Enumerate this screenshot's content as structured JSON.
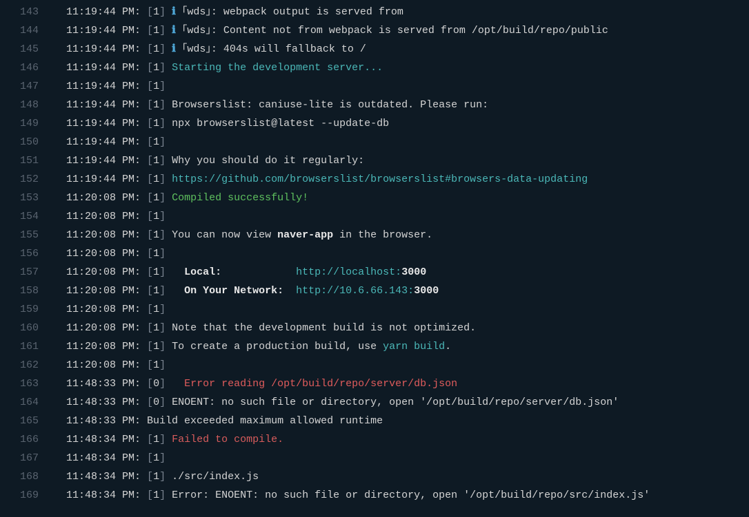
{
  "lines": [
    {
      "num": "143",
      "ts": "11:19:44 PM:",
      "worker": "[1]",
      "segs": [
        {
          "t": " ",
          "c": "txt"
        },
        {
          "t": "ℹ",
          "c": "info-icon"
        },
        {
          "t": " ｢wds｣",
          "c": "wds-bracket"
        },
        {
          "t": ": webpack output is served from",
          "c": "txt"
        }
      ]
    },
    {
      "num": "144",
      "ts": "11:19:44 PM:",
      "worker": "[1]",
      "segs": [
        {
          "t": " ",
          "c": "txt"
        },
        {
          "t": "ℹ",
          "c": "info-icon"
        },
        {
          "t": " ｢wds｣",
          "c": "wds-bracket"
        },
        {
          "t": ": Content not from webpack is served from /opt/build/repo/public",
          "c": "txt"
        }
      ]
    },
    {
      "num": "145",
      "ts": "11:19:44 PM:",
      "worker": "[1]",
      "segs": [
        {
          "t": " ",
          "c": "txt"
        },
        {
          "t": "ℹ",
          "c": "info-icon"
        },
        {
          "t": " ｢wds｣",
          "c": "wds-bracket"
        },
        {
          "t": ": 404s will fallback to /",
          "c": "txt"
        }
      ]
    },
    {
      "num": "146",
      "ts": "11:19:44 PM:",
      "worker": "[1]",
      "segs": [
        {
          "t": " Starting the development server...",
          "c": "cyan"
        }
      ]
    },
    {
      "num": "147",
      "ts": "11:19:44 PM:",
      "worker": "[1]",
      "segs": []
    },
    {
      "num": "148",
      "ts": "11:19:44 PM:",
      "worker": "[1]",
      "segs": [
        {
          "t": " Browserslist: caniuse-lite is outdated. Please run:",
          "c": "txt"
        }
      ]
    },
    {
      "num": "149",
      "ts": "11:19:44 PM:",
      "worker": "[1]",
      "segs": [
        {
          "t": " npx browserslist@latest --update-db",
          "c": "txt"
        }
      ]
    },
    {
      "num": "150",
      "ts": "11:19:44 PM:",
      "worker": "[1]",
      "segs": []
    },
    {
      "num": "151",
      "ts": "11:19:44 PM:",
      "worker": "[1]",
      "segs": [
        {
          "t": " Why you should do it regularly:",
          "c": "txt"
        }
      ]
    },
    {
      "num": "152",
      "ts": "11:19:44 PM:",
      "worker": "[1]",
      "segs": [
        {
          "t": " https://github.com/browserslist/browserslist#browsers-data-updating",
          "c": "link"
        }
      ]
    },
    {
      "num": "153",
      "ts": "11:20:08 PM:",
      "worker": "[1]",
      "segs": [
        {
          "t": " Compiled successfully!",
          "c": "green"
        }
      ]
    },
    {
      "num": "154",
      "ts": "11:20:08 PM:",
      "worker": "[1]",
      "segs": []
    },
    {
      "num": "155",
      "ts": "11:20:08 PM:",
      "worker": "[1]",
      "segs": [
        {
          "t": " You can now view ",
          "c": "txt"
        },
        {
          "t": "naver-app",
          "c": "bold"
        },
        {
          "t": " in the browser.",
          "c": "txt"
        }
      ]
    },
    {
      "num": "156",
      "ts": "11:20:08 PM:",
      "worker": "[1]",
      "segs": []
    },
    {
      "num": "157",
      "ts": "11:20:08 PM:",
      "worker": "[1]",
      "segs": [
        {
          "t": "   ",
          "c": "txt"
        },
        {
          "t": "Local:",
          "c": "bold"
        },
        {
          "t": "            ",
          "c": "txt"
        },
        {
          "t": "http://localhost:",
          "c": "link"
        },
        {
          "t": "3000",
          "c": "port"
        }
      ]
    },
    {
      "num": "158",
      "ts": "11:20:08 PM:",
      "worker": "[1]",
      "segs": [
        {
          "t": "   ",
          "c": "txt"
        },
        {
          "t": "On Your Network:",
          "c": "bold"
        },
        {
          "t": "  ",
          "c": "txt"
        },
        {
          "t": "http://10.6.66.143:",
          "c": "link"
        },
        {
          "t": "3000",
          "c": "port"
        }
      ]
    },
    {
      "num": "159",
      "ts": "11:20:08 PM:",
      "worker": "[1]",
      "segs": []
    },
    {
      "num": "160",
      "ts": "11:20:08 PM:",
      "worker": "[1]",
      "segs": [
        {
          "t": " Note that the development build is not optimized.",
          "c": "txt"
        }
      ]
    },
    {
      "num": "161",
      "ts": "11:20:08 PM:",
      "worker": "[1]",
      "segs": [
        {
          "t": " To create a production build, use ",
          "c": "txt"
        },
        {
          "t": "yarn build",
          "c": "cyan"
        },
        {
          "t": ".",
          "c": "txt"
        }
      ]
    },
    {
      "num": "162",
      "ts": "11:20:08 PM:",
      "worker": "[1]",
      "segs": []
    },
    {
      "num": "163",
      "ts": "11:48:33 PM:",
      "worker": "[0]",
      "segs": [
        {
          "t": "   Error reading /opt/build/repo/server/db.json",
          "c": "red"
        }
      ]
    },
    {
      "num": "164",
      "ts": "11:48:33 PM:",
      "worker": "[0]",
      "segs": [
        {
          "t": " ENOENT: no such file or directory, open '/opt/build/repo/server/db.json'",
          "c": "txt"
        }
      ]
    },
    {
      "num": "165",
      "ts": "11:48:33 PM:",
      "worker": null,
      "segs": [
        {
          "t": "Build exceeded maximum allowed runtime",
          "c": "txt"
        }
      ]
    },
    {
      "num": "166",
      "ts": "11:48:34 PM:",
      "worker": "[1]",
      "segs": [
        {
          "t": " Failed to compile.",
          "c": "orange-red"
        }
      ]
    },
    {
      "num": "167",
      "ts": "11:48:34 PM:",
      "worker": "[1]",
      "segs": []
    },
    {
      "num": "168",
      "ts": "11:48:34 PM:",
      "worker": "[1]",
      "segs": [
        {
          "t": " ./src/index.js",
          "c": "txt"
        }
      ]
    },
    {
      "num": "169",
      "ts": "11:48:34 PM:",
      "worker": "[1]",
      "segs": [
        {
          "t": " Error: ENOENT: no such file or directory, open '/opt/build/repo/src/index.js'",
          "c": "txt"
        }
      ]
    }
  ]
}
